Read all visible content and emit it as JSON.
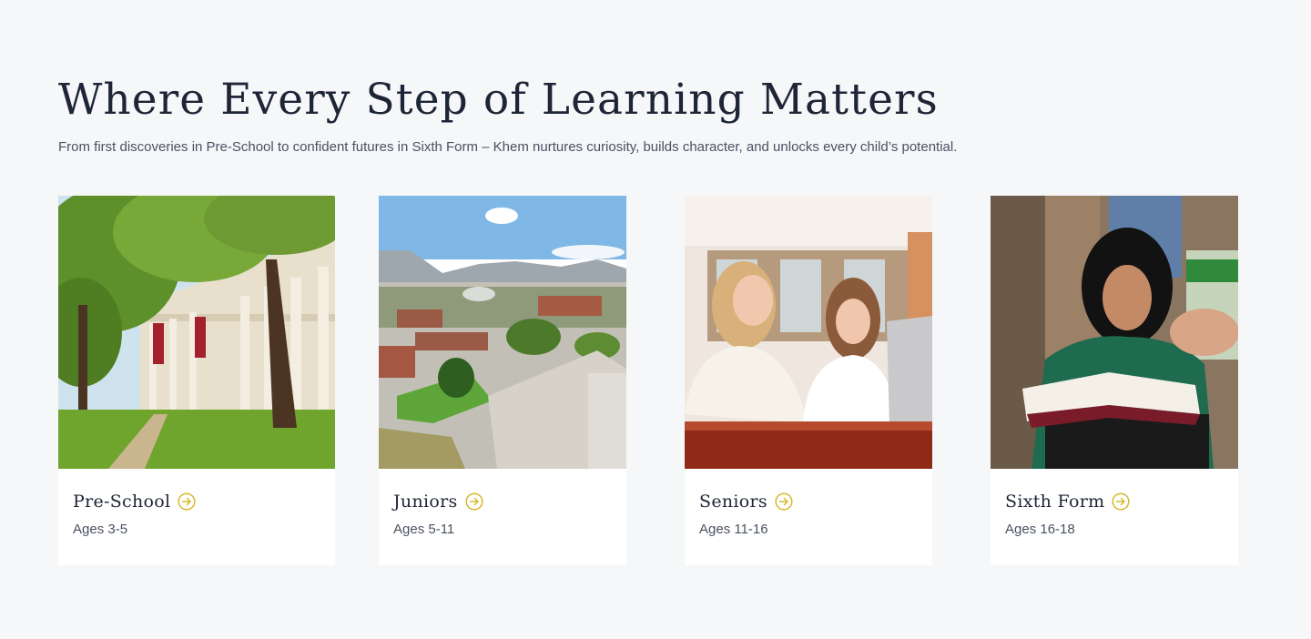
{
  "section": {
    "heading": "Where Every Step of Learning Matters",
    "subtitle": "From first discoveries in Pre-School to confident futures in Sixth Form – Khem nurtures curiosity, builds character, and unlocks every child’s potential."
  },
  "cards": [
    {
      "title": "Pre-School",
      "ages": "Ages 3-5",
      "image": "campus-building-with-trees"
    },
    {
      "title": "Juniors",
      "ages": "Ages 5-11",
      "image": "aerial-campus-with-mountains"
    },
    {
      "title": "Seniors",
      "ages": "Ages 11-16",
      "image": "two-students-at-laptop"
    },
    {
      "title": "Sixth Form",
      "ages": "Ages 16-18",
      "image": "student-reading-book"
    }
  ],
  "colors": {
    "background": "#f6f7f9",
    "heading": "#1e2536",
    "body_text": "#4a5160",
    "accent_arrow": "#d9b62c",
    "card": "#ffffff"
  },
  "icons": {
    "card_link": "arrow-right-circle-icon"
  }
}
